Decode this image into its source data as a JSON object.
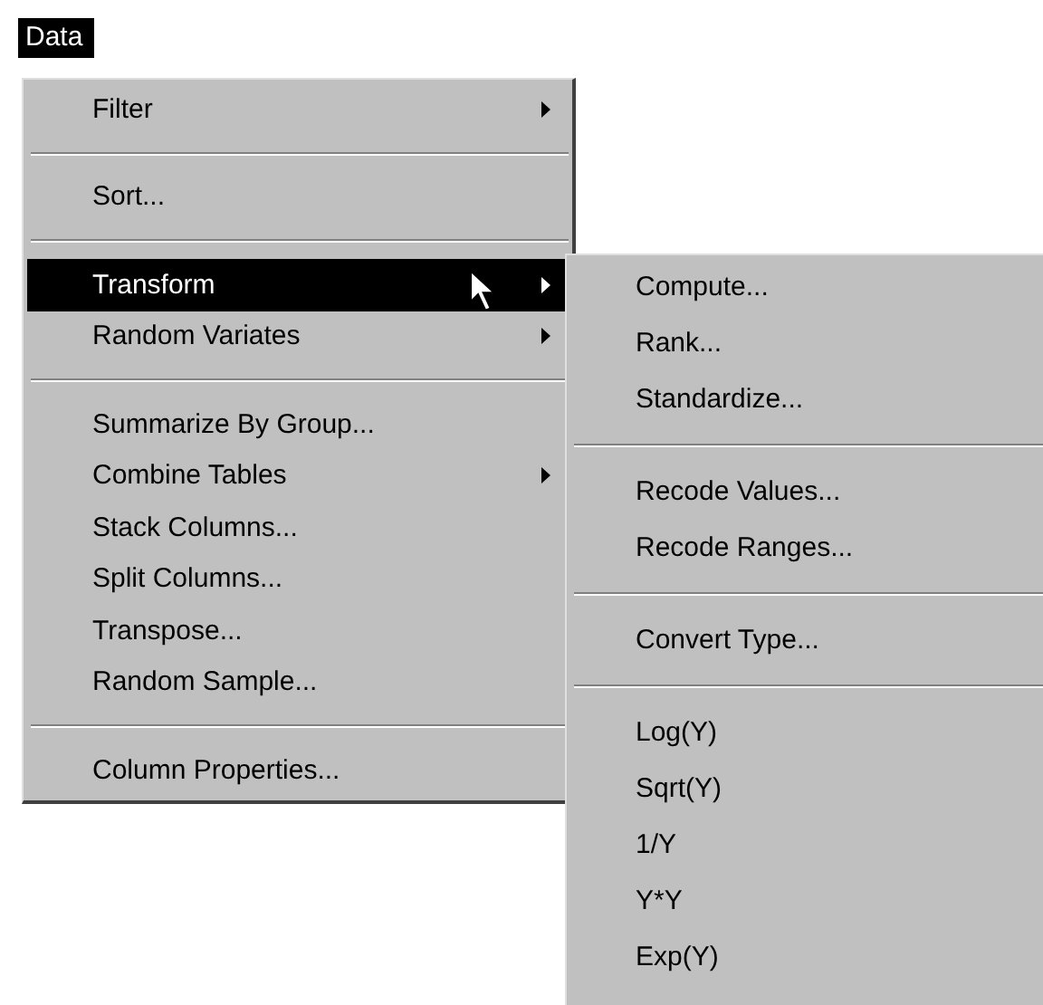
{
  "menu_bar": {
    "title": "Data",
    "selected": true
  },
  "menu": [
    {
      "kind": "item",
      "label": "Filter",
      "submenu": true,
      "selected": false
    },
    {
      "kind": "separator"
    },
    {
      "kind": "item",
      "label": "Sort...",
      "submenu": false,
      "selected": false
    },
    {
      "kind": "separator"
    },
    {
      "kind": "item",
      "label": "Transform",
      "submenu": true,
      "selected": true
    },
    {
      "kind": "item",
      "label": "Random Variates",
      "submenu": true,
      "selected": false
    },
    {
      "kind": "separator"
    },
    {
      "kind": "item",
      "label": "Summarize By Group...",
      "submenu": false,
      "selected": false
    },
    {
      "kind": "item",
      "label": "Combine Tables",
      "submenu": true,
      "selected": false
    },
    {
      "kind": "item",
      "label": "Stack Columns...",
      "submenu": false,
      "selected": false
    },
    {
      "kind": "item",
      "label": "Split Columns...",
      "submenu": false,
      "selected": false
    },
    {
      "kind": "item",
      "label": "Transpose...",
      "submenu": false,
      "selected": false
    },
    {
      "kind": "item",
      "label": "Random Sample...",
      "submenu": false,
      "selected": false
    },
    {
      "kind": "separator"
    },
    {
      "kind": "item",
      "label": "Column Properties...",
      "submenu": false,
      "selected": false
    }
  ],
  "submenu": [
    {
      "kind": "item",
      "label": "Compute..."
    },
    {
      "kind": "item",
      "label": "Rank..."
    },
    {
      "kind": "item",
      "label": "Standardize..."
    },
    {
      "kind": "separator"
    },
    {
      "kind": "item",
      "label": "Recode Values..."
    },
    {
      "kind": "item",
      "label": "Recode Ranges..."
    },
    {
      "kind": "separator"
    },
    {
      "kind": "item",
      "label": "Convert Type..."
    },
    {
      "kind": "separator"
    },
    {
      "kind": "item",
      "label": "Log(Y)"
    },
    {
      "kind": "item",
      "label": "Sqrt(Y)"
    },
    {
      "kind": "item",
      "label": "1/Y"
    },
    {
      "kind": "item",
      "label": "Y*Y"
    },
    {
      "kind": "item",
      "label": "Exp(Y)"
    }
  ]
}
